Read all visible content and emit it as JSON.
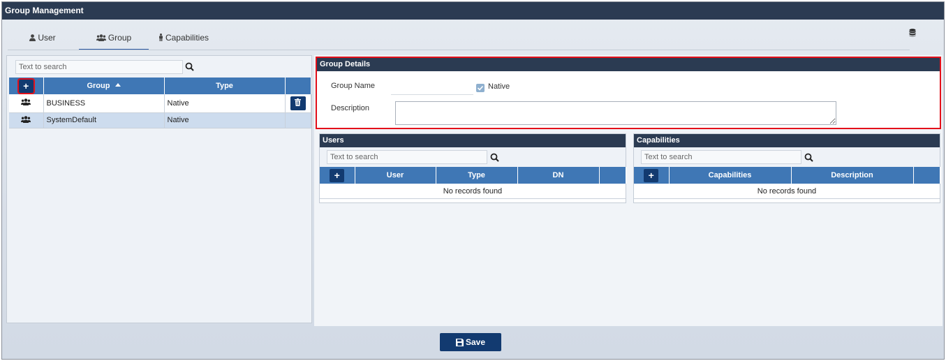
{
  "window": {
    "title": "Group Management"
  },
  "tabs": [
    {
      "label": "User",
      "icon": "user-icon"
    },
    {
      "label": "Group",
      "icon": "users-icon",
      "active": true
    },
    {
      "label": "Capabilities",
      "icon": "person-icon"
    }
  ],
  "groups_panel": {
    "search_placeholder": "Text to search",
    "columns": [
      "Group",
      "Type"
    ],
    "sort": {
      "column": "Group",
      "direction": "asc"
    },
    "rows": [
      {
        "group": "BUSINESS",
        "type": "Native"
      },
      {
        "group": "SystemDefault",
        "type": "Native",
        "selected": true
      }
    ]
  },
  "group_details": {
    "title": "Group Details",
    "group_name_label": "Group Name",
    "group_name_value": "",
    "native_label": "Native",
    "native_checked": true,
    "description_label": "Description",
    "description_value": ""
  },
  "users_panel": {
    "title": "Users",
    "search_placeholder": "Text to search",
    "columns": [
      "User",
      "Type",
      "DN"
    ],
    "empty_text": "No records found"
  },
  "capabilities_panel": {
    "title": "Capabilities",
    "search_placeholder": "Text to search",
    "columns": [
      "Capabilities",
      "Description"
    ],
    "empty_text": "No records found"
  },
  "footer": {
    "save_label": "Save"
  },
  "colors": {
    "header_dark": "#2b3b52",
    "grid_header": "#3f77b5",
    "button_dark": "#123a70",
    "highlight_red": "#e3101a",
    "selected_row": "#cddcee"
  }
}
